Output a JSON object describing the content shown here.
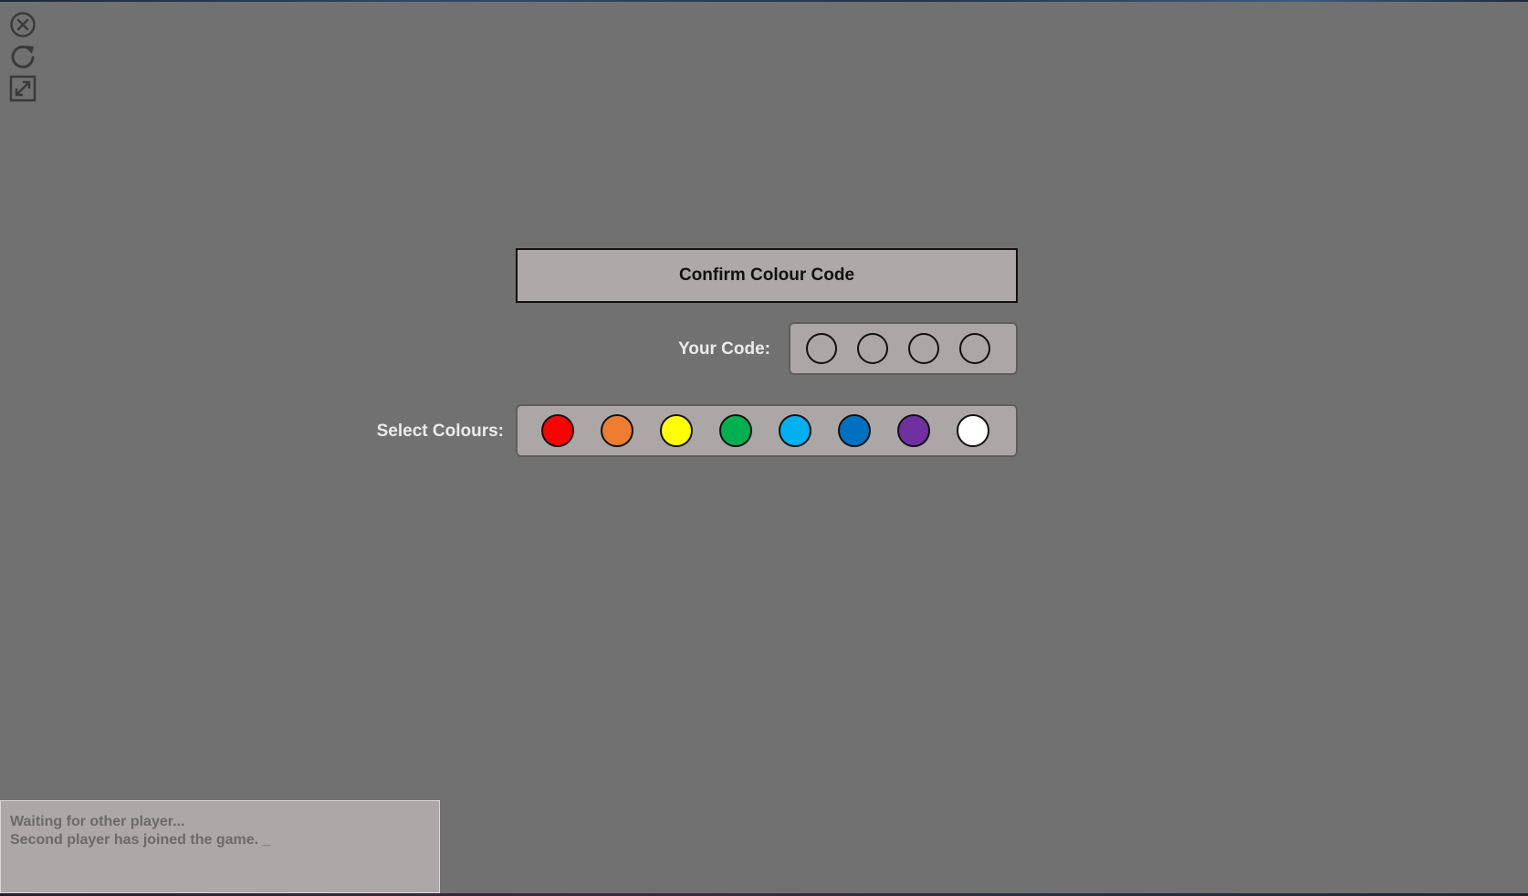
{
  "toolbar": {
    "icons": [
      {
        "name": "close-icon"
      },
      {
        "name": "refresh-icon"
      },
      {
        "name": "fullscreen-icon"
      }
    ],
    "icon_color": "#3a3a3a"
  },
  "confirm_button": {
    "label": "Confirm Colour Code"
  },
  "code_row": {
    "label": "Your Code:",
    "slots": [
      "empty",
      "empty",
      "empty",
      "empty"
    ]
  },
  "colour_row": {
    "label": "Select Colours:",
    "colours": [
      {
        "name": "red",
        "hex": "#ff0000"
      },
      {
        "name": "orange",
        "hex": "#ed7d31"
      },
      {
        "name": "yellow",
        "hex": "#ffff00"
      },
      {
        "name": "green",
        "hex": "#00b050"
      },
      {
        "name": "light-blue",
        "hex": "#00b0f0"
      },
      {
        "name": "blue",
        "hex": "#0070c0"
      },
      {
        "name": "purple",
        "hex": "#7030a0"
      },
      {
        "name": "white",
        "hex": "#ffffff"
      }
    ]
  },
  "log": {
    "lines": [
      "Waiting for other player...",
      "Second player has joined the game. _"
    ]
  },
  "colors": {
    "background": "#717171",
    "panel": "#aba7a6",
    "label_text": "#ebebeb"
  }
}
